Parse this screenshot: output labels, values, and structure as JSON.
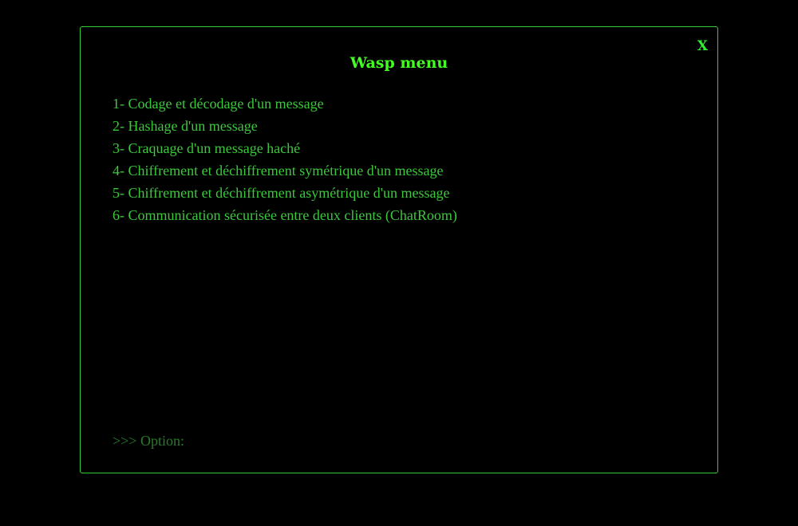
{
  "window": {
    "title": "Wasp menu",
    "close_label": "X"
  },
  "menu": {
    "items": [
      {
        "label": "1- Codage et décodage d'un message"
      },
      {
        "label": "2- Hashage d'un message"
      },
      {
        "label": "3- Craquage d'un message haché"
      },
      {
        "label": "4- Chiffrement et déchiffrement symétrique d'un message"
      },
      {
        "label": "5- Chiffrement et déchiffrement asymétrique d'un message"
      },
      {
        "label": "6- Communication sécurisée entre deux clients (ChatRoom)"
      }
    ]
  },
  "prompt": {
    "label": ">>> Option:",
    "value": ""
  },
  "colors": {
    "background": "#000000",
    "border": "#33cc33",
    "title": "#44ff22",
    "text": "#3cc83c",
    "prompt": "#2a7a2a"
  }
}
